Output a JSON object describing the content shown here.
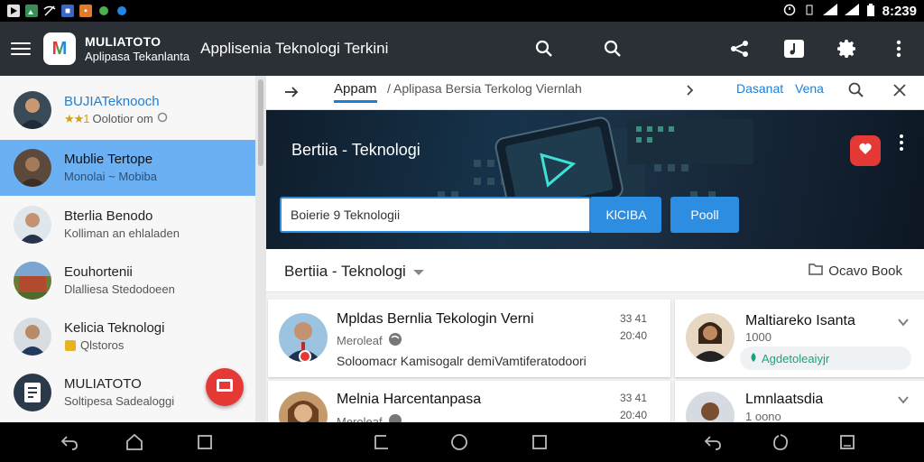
{
  "status_bar": {
    "left_icons": [
      "media-icon",
      "gallery-icon",
      "wifi-off-icon",
      "app-icon",
      "photo-icon",
      "bug-icon",
      "browser-icon"
    ],
    "time": "8:239"
  },
  "app_bar": {
    "app_name": "MULIATOTO",
    "app_subtitle": "Aplipasa Tekanlanta",
    "title": "Applisenia Teknologi Terkini",
    "logo_letter": "M",
    "actions": [
      "search-icon",
      "search-icon",
      "share-icon",
      "music-note-icon",
      "gear-icon",
      "more-vert-icon"
    ]
  },
  "drawer": {
    "items": [
      {
        "title": "BUJIATeknooch",
        "subtitle": "Oolotior om",
        "stars": "★★1",
        "active": false
      },
      {
        "title": "Mublie Tertope",
        "subtitle": "Monolai ~ Mobiba",
        "active": true
      },
      {
        "title": "Bterlia Benodo",
        "subtitle": "Kolliman an ehlaladen",
        "active": false
      },
      {
        "title": "Eouhortenii",
        "subtitle": "Dlalliesa Stedodoeen",
        "active": false
      },
      {
        "title": "Kelicia Teknologi",
        "subtitle": "Qlstoros",
        "active": false
      },
      {
        "title": "MULIATOTO",
        "subtitle": "Soltipesa Sadealoggi",
        "active": false
      }
    ]
  },
  "content": {
    "tab_label": "Appam",
    "breadcrumb": "/ Aplipasa Bersia Terkolog Viernlah",
    "link_1": "Dasanat",
    "link_2": "Vena",
    "hero": {
      "title": "Bertiia - Teknologi",
      "search_value": "Boierie 9 Teknologii",
      "search_button": "KlCIBA",
      "post_button": "Pooll"
    },
    "section_title": "Bertiia - Teknologi",
    "save_book": "Ocavo Book",
    "cards": [
      {
        "title": "Mpldas Bernlia Tekologin Verni",
        "meta": "Meroleaf",
        "num_top": "33 41",
        "num_bottom": "20:40",
        "desc": "Soloomacr Kamisogalr demiVamtiferatodoori"
      },
      {
        "title": "Maltiareko Isanta",
        "meta": "1000",
        "pill": "Agdetoleaiyjr"
      },
      {
        "title": "Melnia Harcentanpasa",
        "meta": "Meroleaf",
        "num_top": "33 41",
        "num_bottom": "20:40"
      },
      {
        "title": "Lmnlaatsdia",
        "meta": "1 oono"
      }
    ]
  },
  "nav_bar": {
    "buttons": [
      "back-icon",
      "home-icon",
      "recents-icon",
      "back-icon",
      "home-icon",
      "recents-icon",
      "back-icon",
      "home-icon",
      "recents-icon"
    ]
  }
}
